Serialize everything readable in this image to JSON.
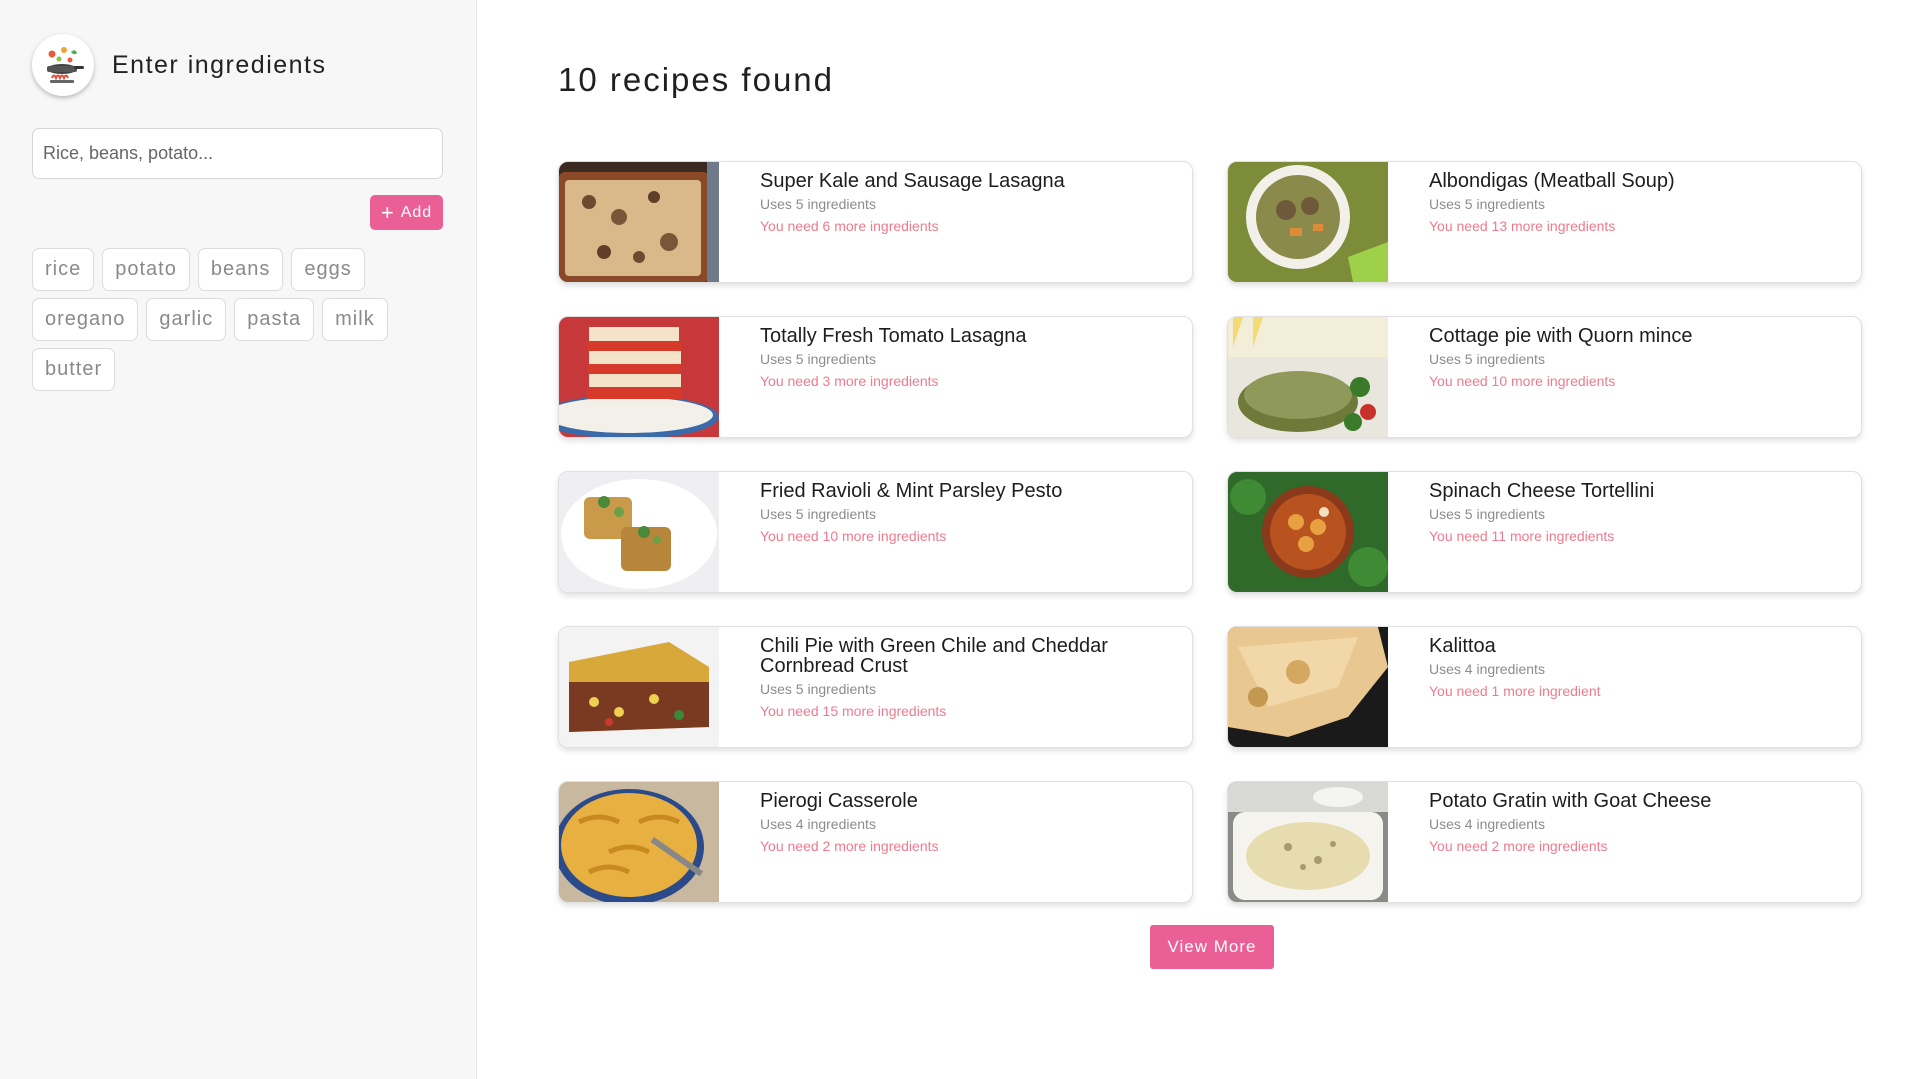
{
  "sidebar": {
    "title": "Enter ingredients",
    "logo_icon": "chef-cooking-icon",
    "search": {
      "placeholder": "Rice, beans, potato...",
      "value": ""
    },
    "add_label": "Add",
    "ingredients": [
      "rice",
      "potato",
      "beans",
      "eggs",
      "oregano",
      "garlic",
      "pasta",
      "milk",
      "butter"
    ]
  },
  "main": {
    "results_title": "10 recipes found",
    "recipes": [
      {
        "title": "Super Kale and Sausage Lasagna",
        "uses": "Uses 5 ingredients",
        "need": "You need 6 more ingredients"
      },
      {
        "title": "Albondigas (Meatball Soup)",
        "uses": "Uses 5 ingredients",
        "need": "You need 13 more ingredients"
      },
      {
        "title": "Totally Fresh Tomato Lasagna",
        "uses": "Uses 5 ingredients",
        "need": "You need 3 more ingredients"
      },
      {
        "title": "Cottage pie with Quorn mince",
        "uses": "Uses 5 ingredients",
        "need": "You need 10 more ingredients"
      },
      {
        "title": "Fried Ravioli & Mint Parsley Pesto",
        "uses": "Uses 5 ingredients",
        "need": "You need 10 more ingredients"
      },
      {
        "title": "Spinach Cheese Tortellini",
        "uses": "Uses 5 ingredients",
        "need": "You need 11 more ingredients"
      },
      {
        "title": "Chili Pie with Green Chile and Cheddar Cornbread Crust",
        "uses": "Uses 5 ingredients",
        "need": "You need 15 more ingredients"
      },
      {
        "title": "Kalittoa",
        "uses": "Uses 4 ingredients",
        "need": "You need 1 more ingredient"
      },
      {
        "title": "Pierogi Casserole",
        "uses": "Uses 4 ingredients",
        "need": "You need 2 more ingredients"
      },
      {
        "title": "Potato Gratin with Goat Cheese",
        "uses": "Uses 4 ingredients",
        "need": "You need 2 more ingredients"
      }
    ],
    "view_more_label": "View More"
  },
  "colors": {
    "accent": "#ea5f95",
    "need_text": "#ef7a8e",
    "sidebar_bg": "#f7f7f7"
  }
}
